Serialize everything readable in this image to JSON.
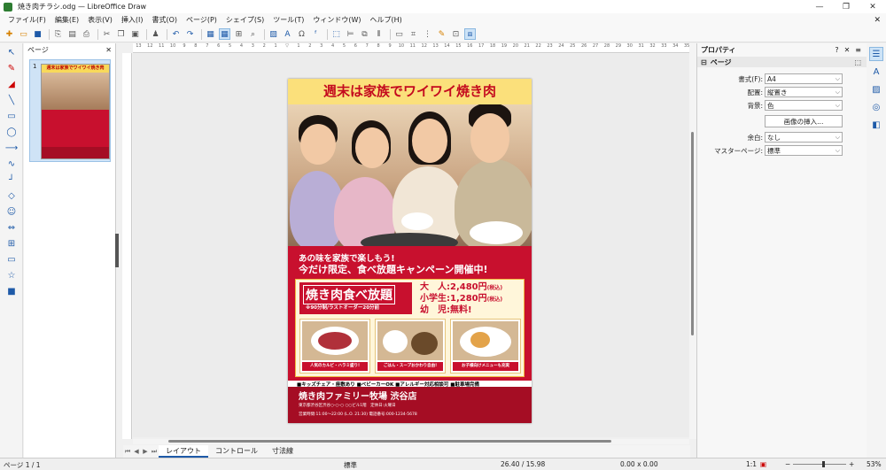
{
  "window": {
    "title": "焼き肉チラシ.odg — LibreOffice Draw",
    "min": "—",
    "max": "❐",
    "close": "✕"
  },
  "menu": [
    "ファイル(F)",
    "編集(E)",
    "表示(V)",
    "挿入(I)",
    "書式(O)",
    "ページ(P)",
    "シェイプ(S)",
    "ツール(T)",
    "ウィンドウ(W)",
    "ヘルプ(H)"
  ],
  "pages_pane": {
    "title": "ページ",
    "close": "✕",
    "page_number": "1",
    "thumb_title": "週末は家族でワイワイ焼き肉"
  },
  "ruler_ticks": [
    "13",
    "12",
    "11",
    "10",
    "9",
    "8",
    "7",
    "6",
    "5",
    "4",
    "3",
    "2",
    "1",
    "",
    "1",
    "2",
    "3",
    "4",
    "5",
    "6",
    "7",
    "8",
    "9",
    "10",
    "11",
    "12",
    "13",
    "14",
    "15",
    "16",
    "17",
    "18",
    "19",
    "20",
    "21",
    "22",
    "23",
    "24",
    "25",
    "26",
    "27",
    "28",
    "29",
    "30",
    "31",
    "32",
    "33",
    "34",
    "35",
    "36",
    "37",
    "38",
    "39",
    "40",
    "41",
    "42",
    "43",
    "44",
    "45",
    "46",
    "47",
    "48"
  ],
  "flyer": {
    "headline": "週末は家族でワイワイ焼き肉",
    "tagline1": "あの味を家族で楽しもう!",
    "tagline2": "今だけ限定、食べ放題キャンペーン開催中!",
    "box_title": "焼き肉食べ放題",
    "box_sub": "※90分制/ラストオーダー20分前",
    "price_adult": "大　人:2,480円",
    "price_child": "小学生:1,280円",
    "price_infant": "幼　児:無料!",
    "tax": "(税込)",
    "food1": "人気のカルビ・ハラミ盛り!",
    "food2": "ごはん・スープおかわり自由!",
    "food3": "お子様向けメニューも充実",
    "features": "■キッズチェア・座敷あり ■ベビーカーOK ■アレルギー対応相談可 ■駐車場完備",
    "shop": "焼き肉ファミリー牧場 渋谷店",
    "address": "東京都渋谷区渋谷○-○-○ ○○ビル1階　定休日:火曜日",
    "hours": "営業時間:11:00〜22:00 (L.O. 21:30) 電話番号:000-1234-5678"
  },
  "tabs": [
    "レイアウト",
    "コントロール",
    "寸法線"
  ],
  "sidebar": {
    "title": "プロパティ",
    "help": "?",
    "close": "✕",
    "menu": "≡",
    "section": "ページ",
    "format_label": "書式(F):",
    "format_value": "A4",
    "orientation_label": "配置:",
    "orientation_value": "縦置き",
    "background_label": "背景:",
    "background_value": "色",
    "insert_image": "画像の挿入...",
    "margin_label": "余白:",
    "margin_value": "なし",
    "master_label": "マスターページ:",
    "master_value": "標準"
  },
  "status": {
    "page": "ページ 1 / 1",
    "master": "標準",
    "position": "26.40 / 15.98",
    "size": "0.00 x 0.00",
    "scale": "1:1",
    "zoom": "53%"
  },
  "colors": {
    "flyer_red": "#c8102e",
    "flyer_yellow": "#fbe07b",
    "selection": "#cde3f7"
  }
}
